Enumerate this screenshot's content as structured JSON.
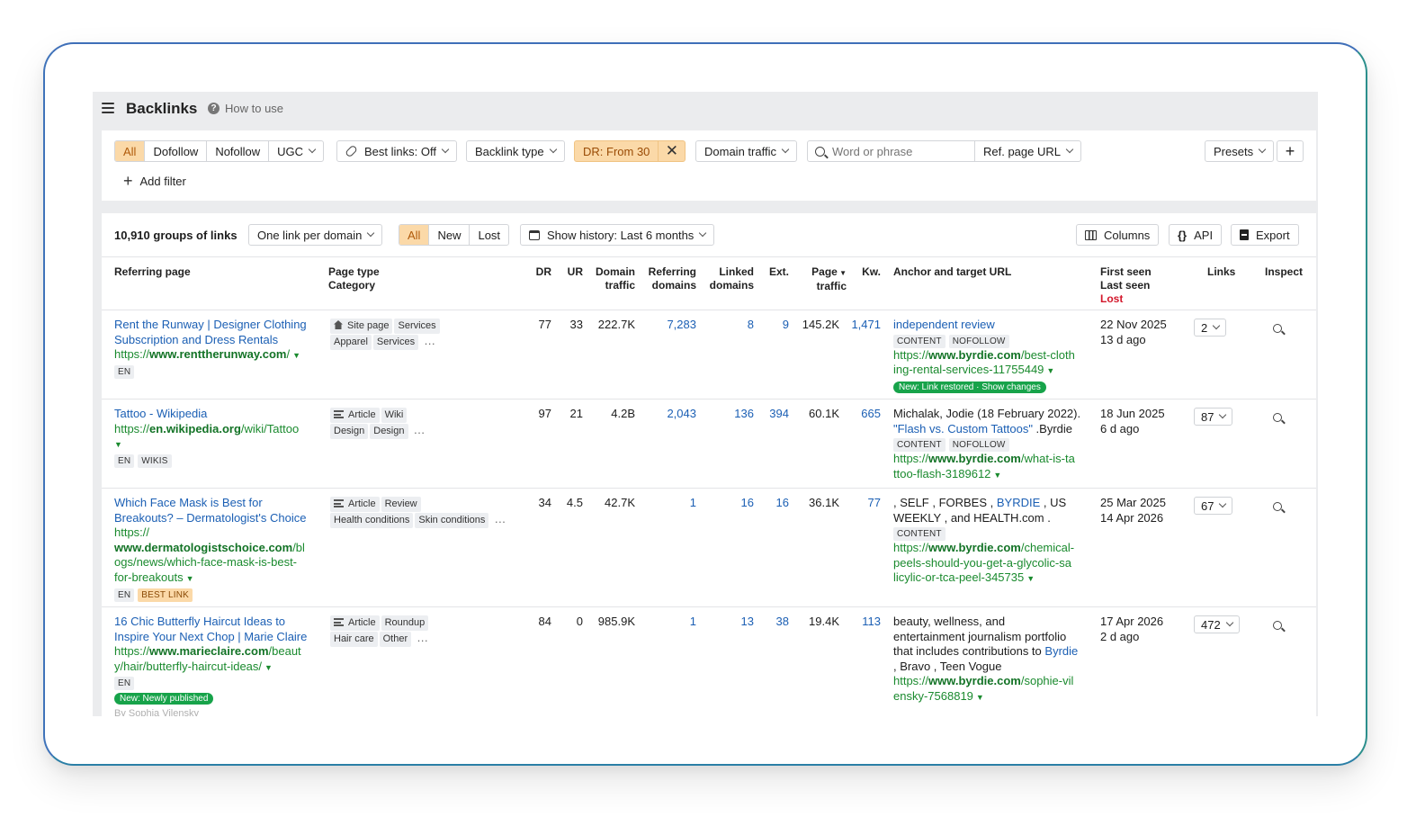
{
  "header": {
    "title": "Backlinks",
    "how_to_use": "How to use"
  },
  "filters": {
    "link_types": [
      "All",
      "Dofollow",
      "Nofollow",
      "UGC"
    ],
    "best_links": "Best links: Off",
    "backlink_type": "Backlink type",
    "dr_filter": "DR: From 30",
    "domain_traffic": "Domain traffic",
    "search_placeholder": "Word or phrase",
    "ref_page_url": "Ref. page URL",
    "presets": "Presets",
    "add_filter": "Add filter"
  },
  "toolbar": {
    "groups_count": "10,910 groups of links",
    "grouping": "One link per domain",
    "status_tabs": [
      "All",
      "New",
      "Lost"
    ],
    "history": "Show history: Last 6 months",
    "columns": "Columns",
    "api": "API",
    "export": "Export"
  },
  "columns": {
    "referring_page": "Referring page",
    "page_type": "Page type",
    "category": "Category",
    "dr": "DR",
    "ur": "UR",
    "domain_traffic_1": "Domain",
    "domain_traffic_2": "traffic",
    "ref_domains_1": "Referring",
    "ref_domains_2": "domains",
    "linked_domains_1": "Linked",
    "linked_domains_2": "domains",
    "ext": "Ext.",
    "page_traffic_1": "Page",
    "page_traffic_2": "traffic",
    "kw": "Kw.",
    "anchor": "Anchor and target URL",
    "first_seen": "First seen",
    "last_seen": "Last seen",
    "lost": "Lost",
    "links": "Links",
    "inspect": "Inspect"
  },
  "rows": [
    {
      "title_1": "Rent the Runway | Designer Clothing",
      "title_2": "Subscription and Dress Rentals",
      "url_prefix": "https://",
      "url_domain": "www.renttherunway.com",
      "url_rest": "/",
      "tags": [
        "EN"
      ],
      "page_type": "Site page",
      "page_type_chip": "Services",
      "categories": [
        "Apparel",
        "Services"
      ],
      "dr": "77",
      "ur": "33",
      "domain_traffic": "222.7K",
      "ref_domains": "7,283",
      "linked_domains": "8",
      "ext": "9",
      "page_traffic": "145.2K",
      "kw": "1,471",
      "anchor_link": "independent review",
      "anchor_tags": [
        "CONTENT",
        "NOFOLLOW"
      ],
      "target_prefix": "https://",
      "target_domain": "www.byrdie.com",
      "target_rest_1": "/best-cloth",
      "target_rest_2": "ing-rental-services-11755449",
      "pill": "New: Link restored · Show changes",
      "first_seen": "22 Nov 2025",
      "last_seen": "13 d ago",
      "links": "2"
    },
    {
      "title_1": "Tattoo - Wikipedia",
      "url_prefix": "https://",
      "url_domain": "en.wikipedia.org",
      "url_rest": "/wiki/Tattoo",
      "tags": [
        "EN",
        "WIKIS"
      ],
      "page_type": "Article",
      "page_type_chip": "Wiki",
      "categories": [
        "Design",
        "Design"
      ],
      "dr": "97",
      "ur": "21",
      "domain_traffic": "4.2B",
      "ref_domains": "2,043",
      "linked_domains": "136",
      "ext": "394",
      "page_traffic": "60.1K",
      "kw": "665",
      "anchor_text_1": "Michalak, Jodie (18 February 2022).",
      "anchor_link": "\"Flash vs. Custom Tattoos\"",
      "anchor_after": " .Byrdie",
      "anchor_tags": [
        "CONTENT",
        "NOFOLLOW"
      ],
      "target_prefix": "https://",
      "target_domain": "www.byrdie.com",
      "target_rest_1": "/what-is-ta",
      "target_rest_2": "ttoo-flash-3189612",
      "first_seen": "18 Jun 2025",
      "last_seen": "6 d ago",
      "links": "87"
    },
    {
      "title_1": "Which Face Mask is Best for",
      "title_2": "Breakouts? – Dermatologist's Choice",
      "url_prefix": "https://",
      "url_domain": "www.dermatologistschoice.com",
      "url_rest_1": "/bl",
      "url_rest_2": "ogs/news/which-face-mask-is-best-",
      "url_rest_3": "for-breakouts",
      "tags": [
        "EN",
        "BEST LINK"
      ],
      "page_type": "Article",
      "page_type_chip": "Review",
      "categories": [
        "Health conditions",
        "Skin conditions"
      ],
      "dr": "34",
      "ur": "4.5",
      "domain_traffic": "42.7K",
      "ref_domains": "1",
      "linked_domains": "16",
      "ext": "16",
      "page_traffic": "36.1K",
      "kw": "77",
      "anchor_text_1": ", SELF , FORBES ,",
      "anchor_link": "BYRDIE",
      "anchor_after": " , US",
      "anchor_text_2": "WEEKLY , and HEALTH.com .",
      "anchor_tags": [
        "CONTENT"
      ],
      "target_prefix": "https://",
      "target_domain": "www.byrdie.com",
      "target_rest_1": "/chemical-",
      "target_rest_2": "peels-should-you-get-a-glycolic-sa",
      "target_rest_3": "licylic-or-tca-peel-345735",
      "first_seen": "25 Mar 2025",
      "last_seen": "14 Apr 2026",
      "links": "67"
    },
    {
      "title_1": "16 Chic Butterfly Haircut Ideas to",
      "title_2": "Inspire Your Next Chop | Marie Claire",
      "url_prefix": "https://",
      "url_domain": "www.marieclaire.com",
      "url_rest_1": "/beaut",
      "url_rest_2": "y/hair/butterfly-haircut-ideas/",
      "tags": [
        "EN"
      ],
      "pill": "New: Newly published",
      "byline": "By Sophia Vilensky",
      "page_type": "Article",
      "page_type_chip": "Roundup",
      "categories": [
        "Hair care",
        "Other"
      ],
      "dr": "84",
      "ur": "0",
      "domain_traffic": "985.9K",
      "ref_domains": "1",
      "linked_domains": "13",
      "ext": "38",
      "page_traffic": "19.4K",
      "kw": "113",
      "anchor_text_1": "beauty, wellness, and",
      "anchor_text_2": "entertainment journalism portfolio",
      "anchor_text_3": "that includes contributions to",
      "anchor_link": "Byrdie",
      "anchor_text_4": ", Bravo , Teen Vogue",
      "target_prefix": "https://",
      "target_domain": "www.byrdie.com",
      "target_rest_1": "/sophie-vil",
      "target_rest_2": "ensky-7568819",
      "first_seen": "17 Apr 2026",
      "last_seen": "2 d ago",
      "links": "472"
    }
  ],
  "colors": {
    "accent_orange": "#fbd9a8",
    "link_blue": "#1b5fb4",
    "url_green": "#1a8a2e",
    "lost_red": "#d3172b"
  }
}
